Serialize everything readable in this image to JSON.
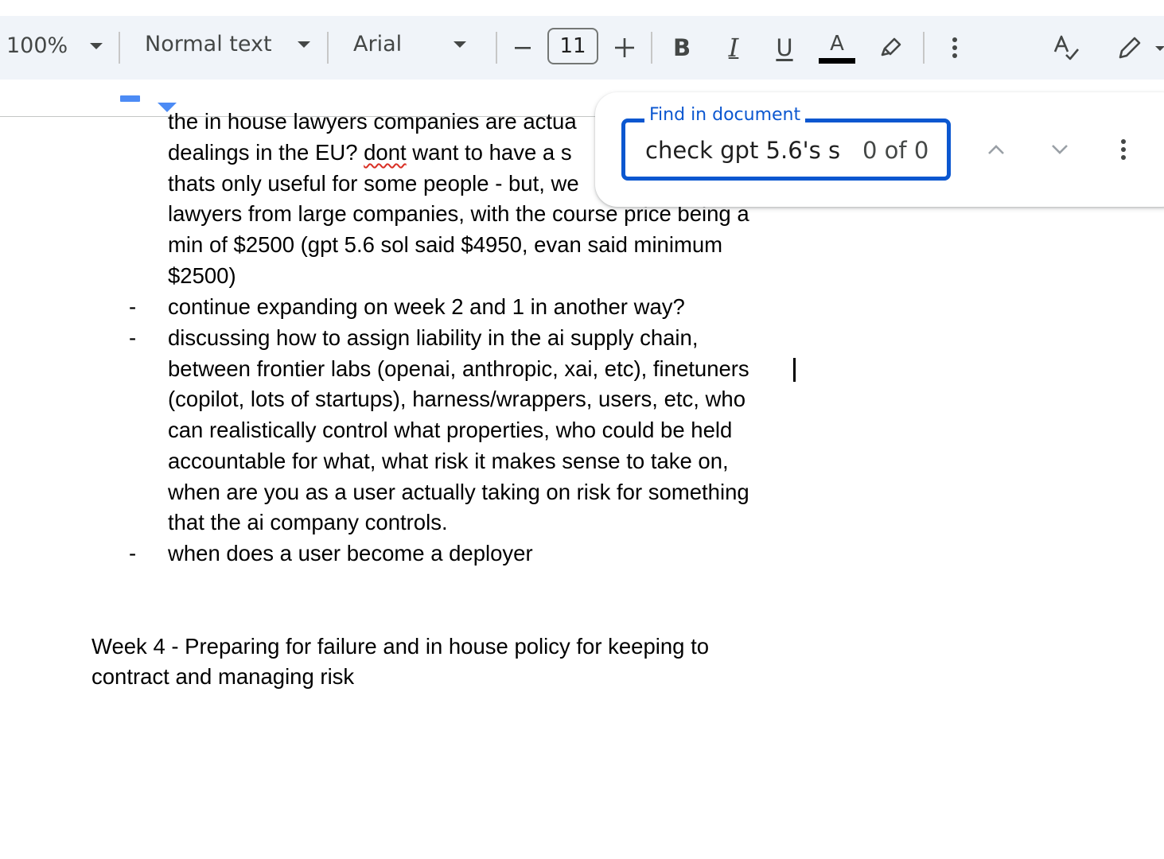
{
  "toolbar": {
    "zoom": "100%",
    "style": "Normal text",
    "font": "Arial",
    "font_size": "11",
    "bold_label": "B",
    "italic_label": "I",
    "underline_label": "U",
    "text_color_label": "A",
    "text_color": "#000000",
    "icons": [
      "chevron-down-icon",
      "minus-icon",
      "plus-icon",
      "highlighter-icon",
      "more-vert-icon",
      "spellcheck-icon",
      "edit-pencil-icon"
    ]
  },
  "document": {
    "lines": [
      "the in house lawyers companies are actua",
      "dealings in the EU? ",
      "dont",
      " want to have a s",
      "thats only useful for some people - but, we",
      "lawyers from large companies, with the course price being a",
      "min of $2500 (gpt 5.6 sol said $4950, evan said minimum",
      "$2500)"
    ],
    "bullet_marker": "-",
    "bullets": [
      [
        "continue expanding on week 2 and 1 in another way?"
      ],
      [
        "discussing how to assign liability in the ai supply chain,",
        "between frontier labs (openai, anthropic, xai, etc), finetuners",
        "(copilot, lots of startups), harness/wrappers, users, etc, who",
        "can realistically control what properties, who could be held",
        "accountable for what, what risk it makes sense to take on,",
        "when are you as a user actually taking on risk for something",
        "that the ai company controls."
      ],
      [
        "when does a user become a deployer"
      ]
    ],
    "heading_lines": [
      "Week 4 - Preparing for failure and in house policy for keeping to",
      "contract and managing risk"
    ]
  },
  "find": {
    "label": "Find in document",
    "value": "check gpt 5.6's s",
    "count": "0 of 0",
    "accent": "#0b57d0"
  }
}
